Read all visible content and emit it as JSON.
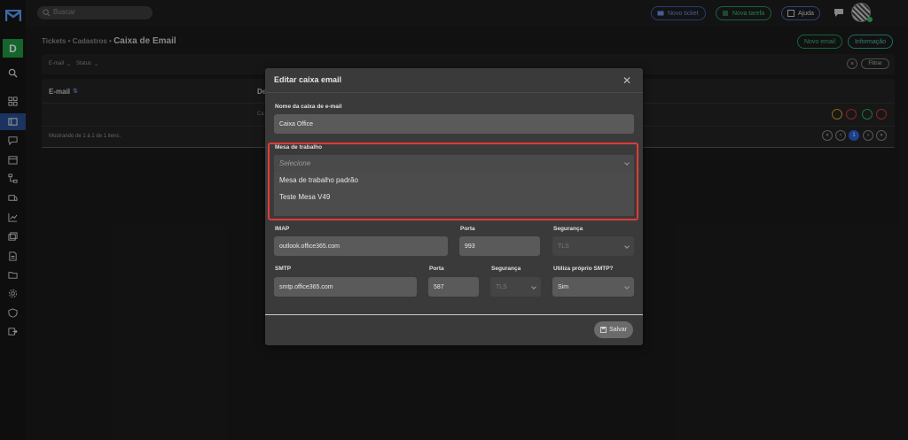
{
  "topbar": {
    "search_placeholder": "Buscar",
    "new_ticket": "Novo ticket",
    "new_task": "Nova tarefa",
    "help": "Ajuda"
  },
  "sidebar": {
    "workspace_letter": "D",
    "icons": [
      "search-icon",
      "dashboard-icon",
      "tickets-icon",
      "chat-icon",
      "calendar-icon",
      "flow-icon",
      "truck-icon",
      "chart-icon",
      "gallery-icon",
      "report-icon",
      "folder-icon",
      "settings-icon",
      "shield-icon",
      "export-icon"
    ]
  },
  "page": {
    "breadcrumb_prefix": "Tickets • Cadastros •",
    "title": "Caixa de Email",
    "new_email_btn": "Novo email",
    "info_btn": "Informação",
    "filter_email": "E-mail",
    "filter_status": "Status",
    "filter_btn": "Filtrar",
    "col_email": "E-mail",
    "col_second": "De",
    "row_cell": "Ca",
    "showing": "Mostrando de 1 à 1 de 1 itens.",
    "current_page": "1"
  },
  "modal": {
    "title": "Editar caixa email",
    "name_label": "Nome da caixa de e-mail",
    "name_value": "Caixa Office",
    "desk_label": "Mesa de trabalho",
    "desk_placeholder": "Selecione",
    "desk_options": [
      "Mesa de trabalho padrão",
      "Teste Mesa V49"
    ],
    "imap_label": "IMAP",
    "imap_value": "outlook.office365.com",
    "imap_port_label": "Porta",
    "imap_port_value": "993",
    "imap_sec_label": "Segurança",
    "imap_sec_value": "TLS",
    "smtp_label": "SMTP",
    "smtp_value": "smtp.office365.com",
    "smtp_port_label": "Porta",
    "smtp_port_value": "587",
    "smtp_sec_label": "Segurança",
    "smtp_sec_value": "TLS",
    "own_smtp_label": "Utiliza próprio SMTP?",
    "own_smtp_value": "Sim",
    "save_btn": "Salvar"
  },
  "colors": {
    "accent_blue": "#2e62d9",
    "accent_green": "#1f9d44",
    "highlight_red": "#e23a3a"
  }
}
